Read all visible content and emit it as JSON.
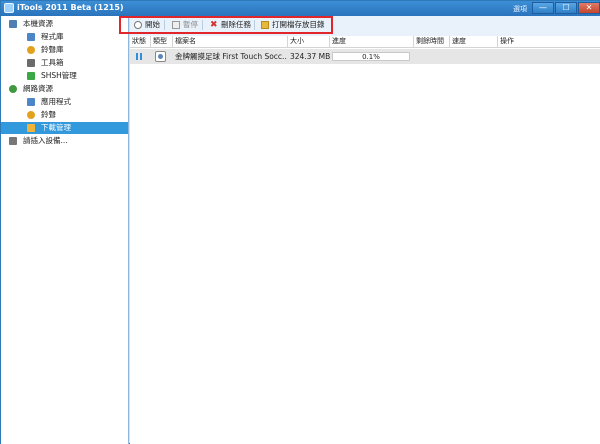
{
  "window": {
    "title": "iTools 2011 Beta (1215)",
    "options_label": "選項",
    "minimize_glyph": "—",
    "maximize_glyph": "☐",
    "close_glyph": "✕"
  },
  "sidebar": {
    "items": [
      {
        "label": "本機資源",
        "icon": "computer-icon",
        "color": "#4d7fb3"
      },
      {
        "label": "程式庫",
        "icon": "app-library-icon",
        "color": "#4d86c8"
      },
      {
        "label": "鈴聲庫",
        "icon": "ringtone-icon",
        "color": "#e2a21e"
      },
      {
        "label": "工具箱",
        "icon": "toolbox-icon",
        "color": "#6b6b6b"
      },
      {
        "label": "SHSH管理",
        "icon": "shsh-icon",
        "color": "#39a845"
      },
      {
        "label": "網路資源",
        "icon": "globe-icon",
        "color": "#3f9a3f"
      },
      {
        "label": "應用程式",
        "icon": "apps-icon",
        "color": "#4d86c8"
      },
      {
        "label": "鈴聲",
        "icon": "ringtone-icon",
        "color": "#e2a21e"
      },
      {
        "label": "下載管理",
        "icon": "download-icon",
        "color": "#f0b43a",
        "active": true
      },
      {
        "label": "請插入設備...",
        "icon": "device-icon",
        "color": "#777777"
      }
    ]
  },
  "toolbar": {
    "start_label": "開始",
    "pause_label": "暫停",
    "delete_label": "刪除任務",
    "open_folder_label": "打開檔存放目錄"
  },
  "table": {
    "columns": [
      "狀態",
      "類型",
      "檔案名",
      "大小",
      "進度",
      "剩餘時間",
      "速度",
      "操作"
    ],
    "rows": [
      {
        "status": "paused",
        "type": "app-package",
        "name": "金牌觸摸足球 First Touch Socc...",
        "size": "324.37 MB",
        "progress_text": "0.1%",
        "progress_fraction": 0.001,
        "remaining": "",
        "speed": "",
        "action": ""
      }
    ]
  },
  "colors": {
    "highlight_box": "#e0262b",
    "active_nav": "#3399dd",
    "title_bar": "#2f7fc6"
  }
}
